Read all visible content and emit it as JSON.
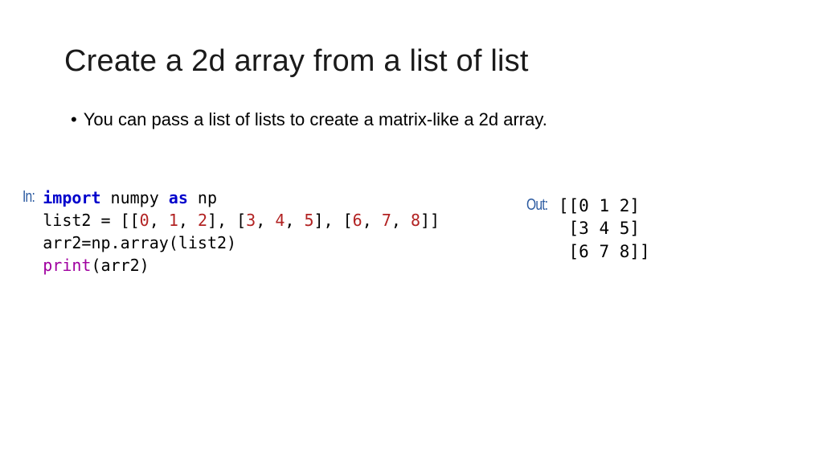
{
  "title": "Create a 2d array from a list of list",
  "bullet": "You can pass a list of lists to create a matrix-like a 2d array.",
  "labels": {
    "in": "In:",
    "out": "Out:"
  },
  "code_in": {
    "l1": {
      "import": "import",
      "numpy": " numpy ",
      "as": "as",
      "np": " np"
    },
    "l2": {
      "a": "list2 = [[",
      "n0": "0",
      "c1": ", ",
      "n1": "1",
      "c2": ", ",
      "n2": "2",
      "mid1": "], [",
      "n3": "3",
      "c3": ", ",
      "n4": "4",
      "c4": ", ",
      "n5": "5",
      "mid2": "], [",
      "n6": "6",
      "c5": ", ",
      "n7": "7",
      "c6": ", ",
      "n8": "8",
      "end": "]]"
    },
    "l3": "arr2=np.array(list2)",
    "l4": {
      "print": "print",
      "rest": "(arr2)"
    }
  },
  "code_out": "[[0 1 2]\n [3 4 5]\n [6 7 8]]"
}
